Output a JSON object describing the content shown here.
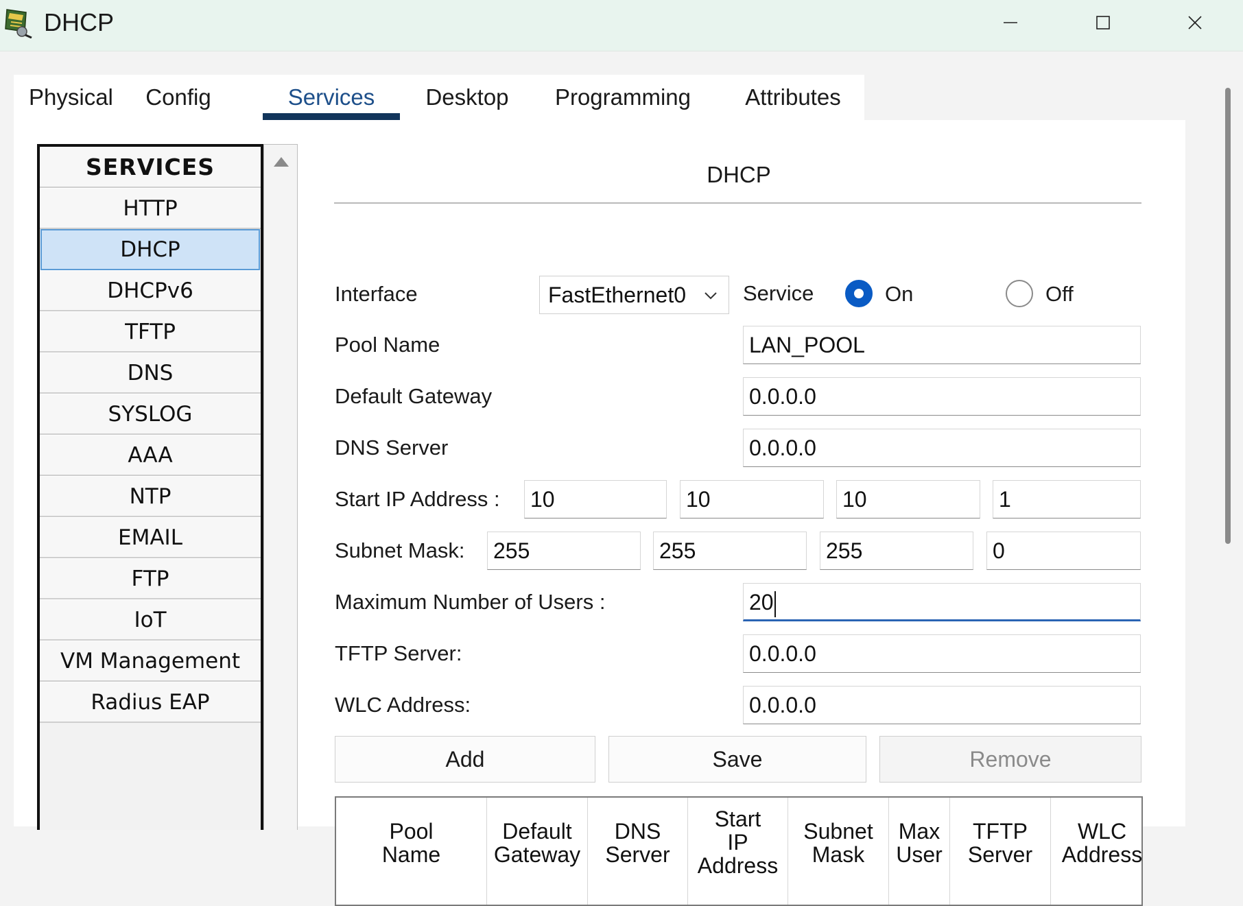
{
  "window": {
    "title": "DHCP",
    "icon": "packet-tracer-server-icon"
  },
  "tabs": [
    {
      "label": "Physical"
    },
    {
      "label": "Config"
    },
    {
      "label": "Services",
      "active": true
    },
    {
      "label": "Desktop"
    },
    {
      "label": "Programming"
    },
    {
      "label": "Attributes"
    }
  ],
  "services": {
    "header": "SERVICES",
    "items": [
      {
        "label": "HTTP"
      },
      {
        "label": "DHCP",
        "selected": true
      },
      {
        "label": "DHCPv6"
      },
      {
        "label": "TFTP"
      },
      {
        "label": "DNS"
      },
      {
        "label": "SYSLOG"
      },
      {
        "label": "AAA"
      },
      {
        "label": "NTP"
      },
      {
        "label": "EMAIL"
      },
      {
        "label": "FTP"
      },
      {
        "label": "IoT"
      },
      {
        "label": "VM Management"
      },
      {
        "label": "Radius EAP"
      }
    ]
  },
  "form": {
    "title": "DHCP",
    "interface_label": "Interface",
    "interface_value": "FastEthernet0",
    "service_label": "Service",
    "on_label": "On",
    "off_label": "Off",
    "service_state": "On",
    "pool_name_label": "Pool Name",
    "pool_name_value": "LAN_POOL",
    "default_gateway_label": "Default Gateway",
    "default_gateway_value": "0.0.0.0",
    "dns_server_label": "DNS Server",
    "dns_server_value": "0.0.0.0",
    "start_ip_label": "Start IP Address :",
    "start_ip": [
      "10",
      "10",
      "10",
      "1"
    ],
    "subnet_mask_label": "Subnet Mask:",
    "subnet_mask": [
      "255",
      "255",
      "255",
      "0"
    ],
    "max_users_label": "Maximum Number of Users :",
    "max_users_value": "20",
    "tftp_server_label": "TFTP Server:",
    "tftp_server_value": "0.0.0.0",
    "wlc_address_label": "WLC Address:",
    "wlc_address_value": "0.0.0.0"
  },
  "buttons": {
    "add": "Add",
    "save": "Save",
    "remove": "Remove"
  },
  "table": {
    "columns": [
      {
        "line1": "Pool",
        "line2": "Name"
      },
      {
        "line1": "Default",
        "line2": "Gateway"
      },
      {
        "line1": "DNS",
        "line2": "Server"
      },
      {
        "line1": "Start",
        "line2": "IP",
        "line3": "Address"
      },
      {
        "line1": "Subnet",
        "line2": "Mask"
      },
      {
        "line1": "Max",
        "line2": "User"
      },
      {
        "line1": "TFTP",
        "line2": "Server"
      },
      {
        "line1": "WLC",
        "line2": "Address"
      }
    ]
  },
  "colors": {
    "accent": "#0a5bc4",
    "tab_underline": "#12355b",
    "selected_item": "#cfe3f7",
    "titlebar": "#e8f4ee"
  }
}
